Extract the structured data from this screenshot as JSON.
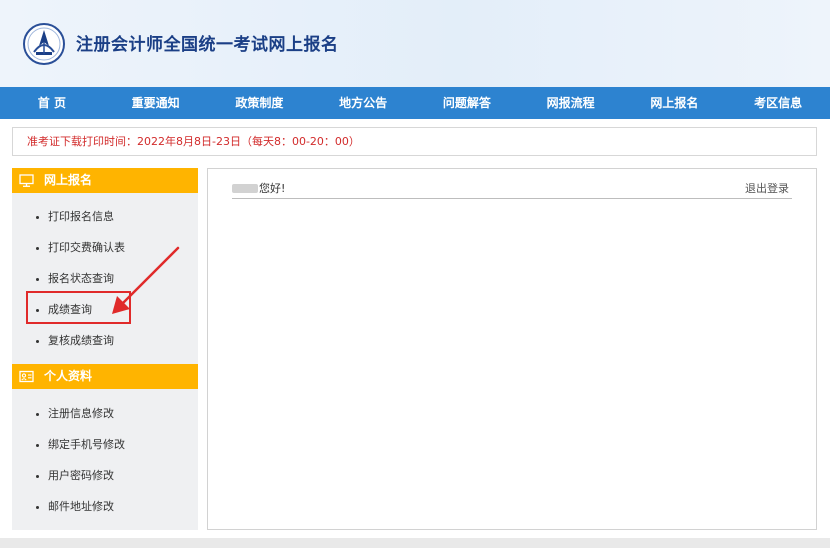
{
  "header": {
    "title": "注册会计师全国统一考试网上报名",
    "logo_icon": "cicpa-emblem-icon"
  },
  "nav": {
    "items": [
      "首 页",
      "重要通知",
      "政策制度",
      "地方公告",
      "问题解答",
      "网报流程",
      "网上报名",
      "考区信息"
    ]
  },
  "notice": {
    "text": "准考证下载打印时间：2022年8月8日-23日（每天8：00-20：00）"
  },
  "sidebar": {
    "sections": [
      {
        "title": "网上报名",
        "icon": "monitor-icon",
        "items": [
          "打印报名信息",
          "打印交费确认表",
          "报名状态查询",
          "成绩查询",
          "复核成绩查询"
        ]
      },
      {
        "title": "个人资料",
        "icon": "id-card-icon",
        "items": [
          "注册信息修改",
          "绑定手机号修改",
          "用户密码修改",
          "邮件地址修改"
        ]
      }
    ]
  },
  "main": {
    "greeting": "您好!",
    "logout": "退出登录"
  },
  "colors": {
    "nav_bg": "#2d83d0",
    "sidebar_header": "#ffb400",
    "notice_text": "#d22b2b",
    "annotation": "#e02a2a"
  }
}
